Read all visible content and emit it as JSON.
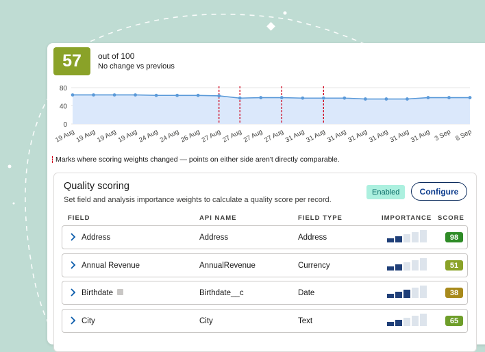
{
  "summary": {
    "score": "57",
    "out_of": "out of 100",
    "change": "No change vs previous",
    "score_color": "#8aa228"
  },
  "chart_data": {
    "type": "area",
    "categories": [
      "19 Aug",
      "19 Aug",
      "19 Aug",
      "19 Aug",
      "24 Aug",
      "24 Aug",
      "26 Aug",
      "27 Aug",
      "27 Aug",
      "27 Aug",
      "27 Aug",
      "31 Aug",
      "31 Aug",
      "31 Aug",
      "31 Aug",
      "31 Aug",
      "31 Aug",
      "31 Aug",
      "3 Sep",
      "8 Sep"
    ],
    "values": [
      64,
      64,
      64,
      64,
      63,
      63,
      63,
      62,
      57,
      58,
      58,
      57,
      57,
      57,
      55,
      55,
      55,
      58,
      58,
      58
    ],
    "yticks": [
      0,
      40,
      80
    ],
    "ylim": [
      0,
      80
    ],
    "weight_change_indices": [
      7,
      8,
      10,
      12
    ],
    "line_color": "#5b9ad9",
    "fill_color": "#dbe8fb",
    "marker_color": "#d0021b",
    "legend_note": "Marks where scoring weights changed — points on either side aren't directly comparable."
  },
  "quality": {
    "title": "Quality scoring",
    "description": "Set field and analysis importance weights to calculate a quality score per record.",
    "status": "Enabled",
    "configure_label": "Configure",
    "columns": {
      "field": "FIELD",
      "api_name": "API NAME",
      "field_type": "FIELD TYPE",
      "importance": "IMPORTANCE",
      "score": "SCORE"
    },
    "rows": [
      {
        "field": "Address",
        "api": "Address",
        "type": "Address",
        "importance": 2,
        "score": "98",
        "score_color": "#2e8b26",
        "info": false
      },
      {
        "field": "Annual Revenue",
        "api": "AnnualRevenue",
        "type": "Currency",
        "importance": 2,
        "score": "51",
        "score_color": "#8aa228",
        "info": false
      },
      {
        "field": "Birthdate",
        "api": "Birthdate__c",
        "type": "Date",
        "importance": 3,
        "score": "38",
        "score_color": "#a88a1c",
        "info": true
      },
      {
        "field": "City",
        "api": "City",
        "type": "Text",
        "importance": 2,
        "score": "65",
        "score_color": "#6e9e2a",
        "info": false
      }
    ],
    "importance_levels": 5,
    "importance_on_color": "#1f3f78",
    "importance_off_color": "#dde4ec"
  }
}
